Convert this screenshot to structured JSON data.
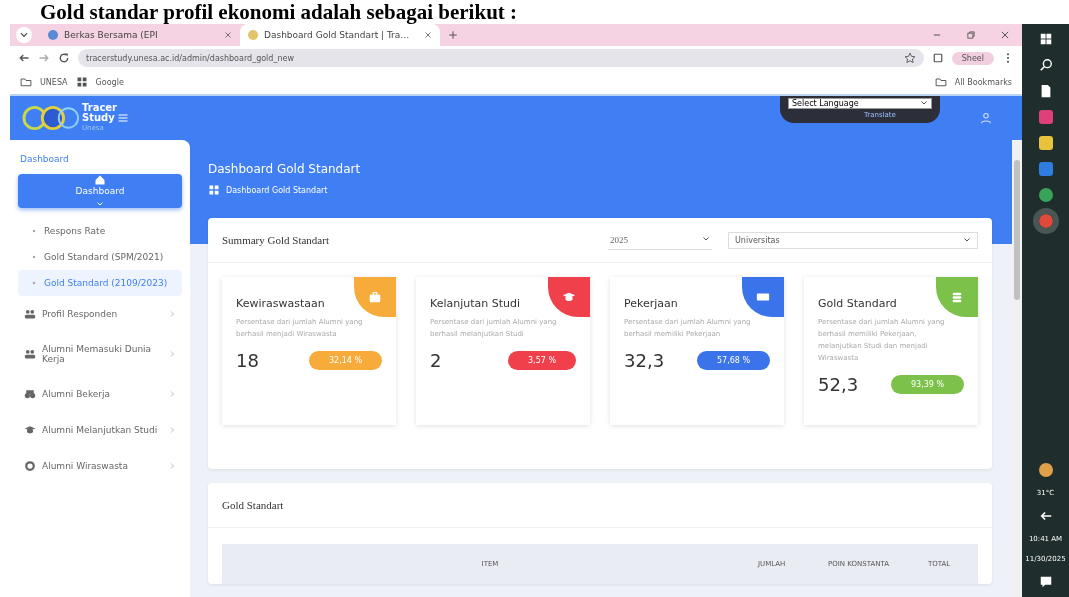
{
  "document_text": "Gold standar profil ekonomi adalah sebagai berikut :",
  "browser": {
    "tabs": [
      {
        "title": "Berkas Bersama (EPI",
        "selected": false
      },
      {
        "title": "Dashboard Gold Standart | Tra…",
        "selected": true
      }
    ],
    "url": "tracerstudy.unesa.ac.id/admin/dashboard_gold_new",
    "profile": "Sheel",
    "bookmarks": [
      "UNESA",
      "Google"
    ],
    "all_bookmarks": "All Bookmarks"
  },
  "topbar": {
    "logo_words": [
      "Tracer",
      "Study",
      "Unesa"
    ],
    "language_select": "Select Language",
    "translate": "Translate"
  },
  "sidebar": {
    "section": "Dashboard",
    "items": [
      {
        "kind": "main",
        "label": "Dashboard",
        "selected": true
      },
      {
        "kind": "sub",
        "label": "Respons Rate",
        "selected": false
      },
      {
        "kind": "sub",
        "label": "Gold Standard (SPM/2021)",
        "selected": false
      },
      {
        "kind": "sub",
        "label": "Gold Standard (2109/2023)",
        "selected": true
      },
      {
        "kind": "menu",
        "label": "Profil Responden",
        "selected": false
      },
      {
        "kind": "menu",
        "label": "Alumni Memasuki Dunia Kerja",
        "selected": false
      },
      {
        "kind": "menu",
        "label": "Alumni Bekerja",
        "selected": false
      },
      {
        "kind": "menu",
        "label": "Alumni Melanjutkan Studi",
        "selected": false
      },
      {
        "kind": "menu",
        "label": "Alumni Wiraswasta",
        "selected": false
      }
    ]
  },
  "header": {
    "title": "Dashboard Gold Standart",
    "breadcrumb": "Dashboard Gold Standart"
  },
  "summary": {
    "title": "Summary Gold Standart",
    "year": "2025",
    "scope": "Universitas",
    "cards": [
      {
        "title": "Kewiraswastaan",
        "description": "Persentase dari jumlah Alumni yang berhasil menjadi Wiraswasta",
        "value": "18",
        "percent": "32,14 %",
        "color": "#f7ab3a"
      },
      {
        "title": "Kelanjutan Studi",
        "description": "Persentase dari jumlah Alumni yang berhasil melanjutkan Studi",
        "value": "2",
        "percent": "3,57 %",
        "color": "#f0404c"
      },
      {
        "title": "Pekerjaan",
        "description": "Persentase dari jumlah Alumni yang berhasil memiliki Pekerjaan",
        "value": "32,3",
        "percent": "57,68 %",
        "color": "#3b74ea"
      },
      {
        "title": "Gold Standard",
        "description": "Persentase dari jumlah Alumni yang berhasil memiliki Pekerjaan, melanjutkan Studi dan menjadi Wiraswasta",
        "value": "52,3",
        "percent": "93,39 %",
        "color": "#7cc24a"
      }
    ]
  },
  "table": {
    "title": "Gold Standart",
    "columns": [
      "ITEM",
      "JUMLAH",
      "POIN KONSTANTA",
      "TOTAL"
    ]
  },
  "taskbar": {
    "weather": "31°C",
    "time": "10:41 AM",
    "date": "11/30/2025"
  }
}
